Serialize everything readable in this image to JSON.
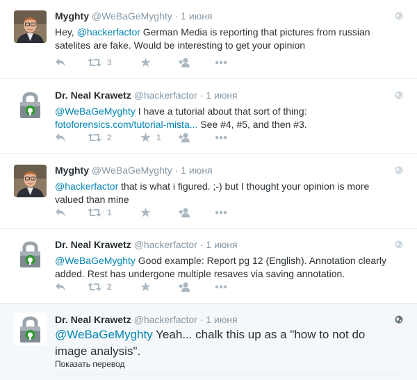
{
  "colors": {
    "link": "#0084b4",
    "muted": "#8899a6",
    "action_icon": "#aab8c2",
    "divider": "#e1e8ed",
    "expanded_bg": "#f5f8fa"
  },
  "tweets": [
    {
      "name": "Myghty",
      "handle": "@WeBaGeMyghty",
      "sep": "·",
      "time": "1 июня",
      "avatar_icon": "person-photo-icon",
      "text_pre": "Hey, ",
      "mention": "@hackerfactor",
      "text_post": " German Media is reporting that pictures from russian satelites are fake. Would be interesting to get your opinion",
      "retweets": "3",
      "favorites": ""
    },
    {
      "name": "Dr. Neal Krawetz",
      "handle": "@hackerfactor",
      "sep": "·",
      "time": "1 июня",
      "avatar_icon": "padlock-icon",
      "mention": "@WeBaGeMyghty",
      "text_mid": " I have a tutorial about that sort of thing: ",
      "link": "fotoforensics.com/tutorial-mista...",
      "text_post": " See #4, #5, and then #3.",
      "retweets": "2",
      "favorites": "1"
    },
    {
      "name": "Myghty",
      "handle": "@WeBaGeMyghty",
      "sep": "·",
      "time": "1 июня",
      "avatar_icon": "person-photo-icon",
      "mention": "@hackerfactor",
      "text_post": " that is what i figured. ;-) but I thought your opinion is more valued than mine",
      "retweets": "1",
      "favorites": ""
    },
    {
      "name": "Dr. Neal Krawetz",
      "handle": "@hackerfactor",
      "sep": "·",
      "time": "1 июня",
      "avatar_icon": "padlock-icon",
      "mention": "@WeBaGeMyghty",
      "text_post": " Good example: Report pg 12 (English). Annotation clearly added. Rest has undergone multiple resaves via saving annotation.",
      "retweets": "2",
      "favorites": ""
    },
    {
      "name": "Dr. Neal Krawetz",
      "handle": "@hackerfactor",
      "sep": "·",
      "time": "1 июня",
      "avatar_icon": "padlock-icon",
      "mention": "@WeBaGeMyghty",
      "text_post": " Yeah... chalk this up as a \"how to not do image analysis\".",
      "translate": "Показать перевод"
    }
  ]
}
